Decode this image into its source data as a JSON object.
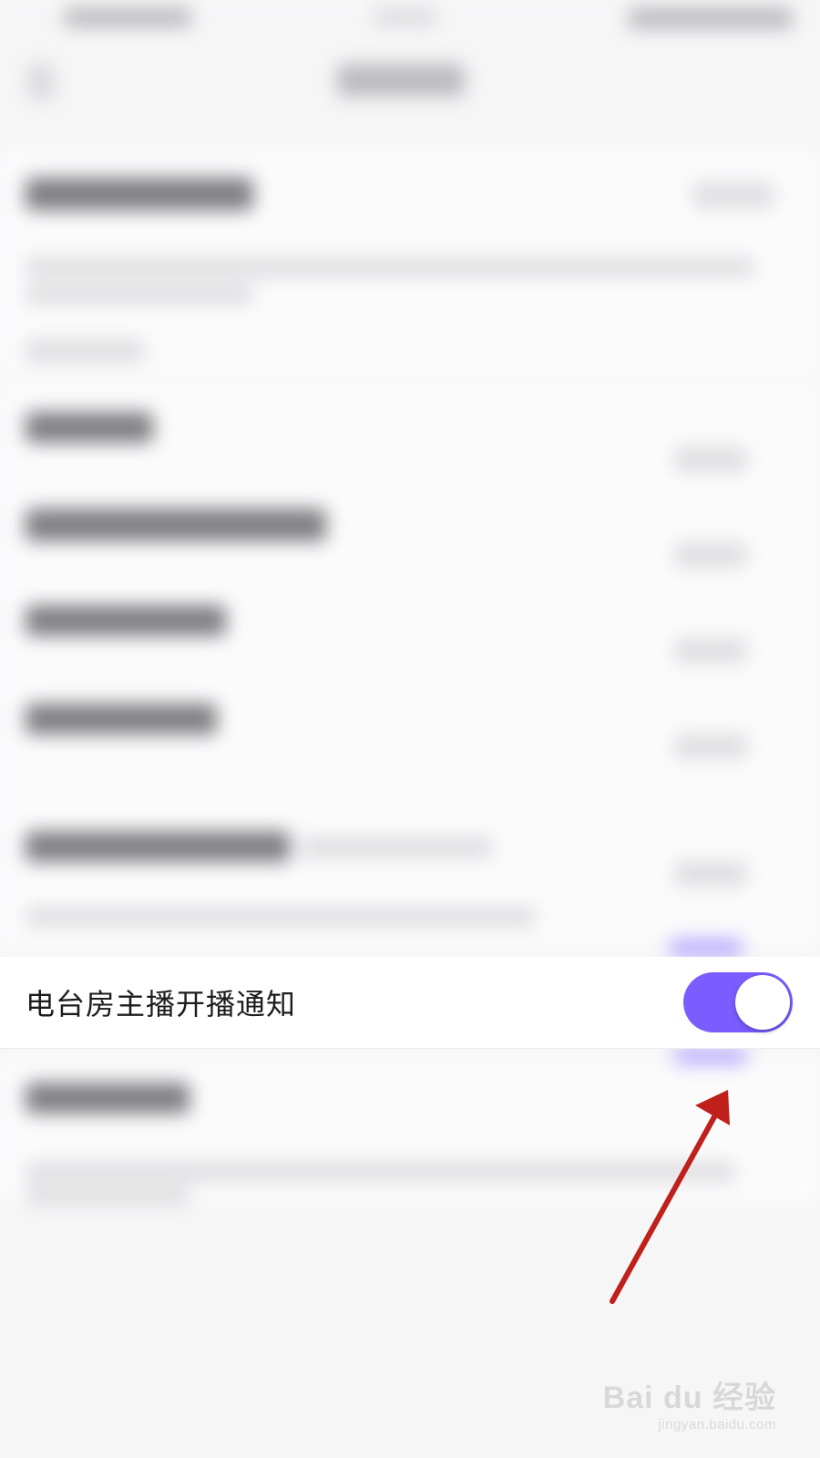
{
  "setting_row": {
    "label": "电台房主播开播通知",
    "toggle_state": "on",
    "toggle_color": "#7b5cff"
  },
  "annotation": {
    "arrow_color": "#c0201c"
  },
  "watermark": {
    "logo": "Bai du 经验",
    "url": "jingyan.baidu.com"
  }
}
